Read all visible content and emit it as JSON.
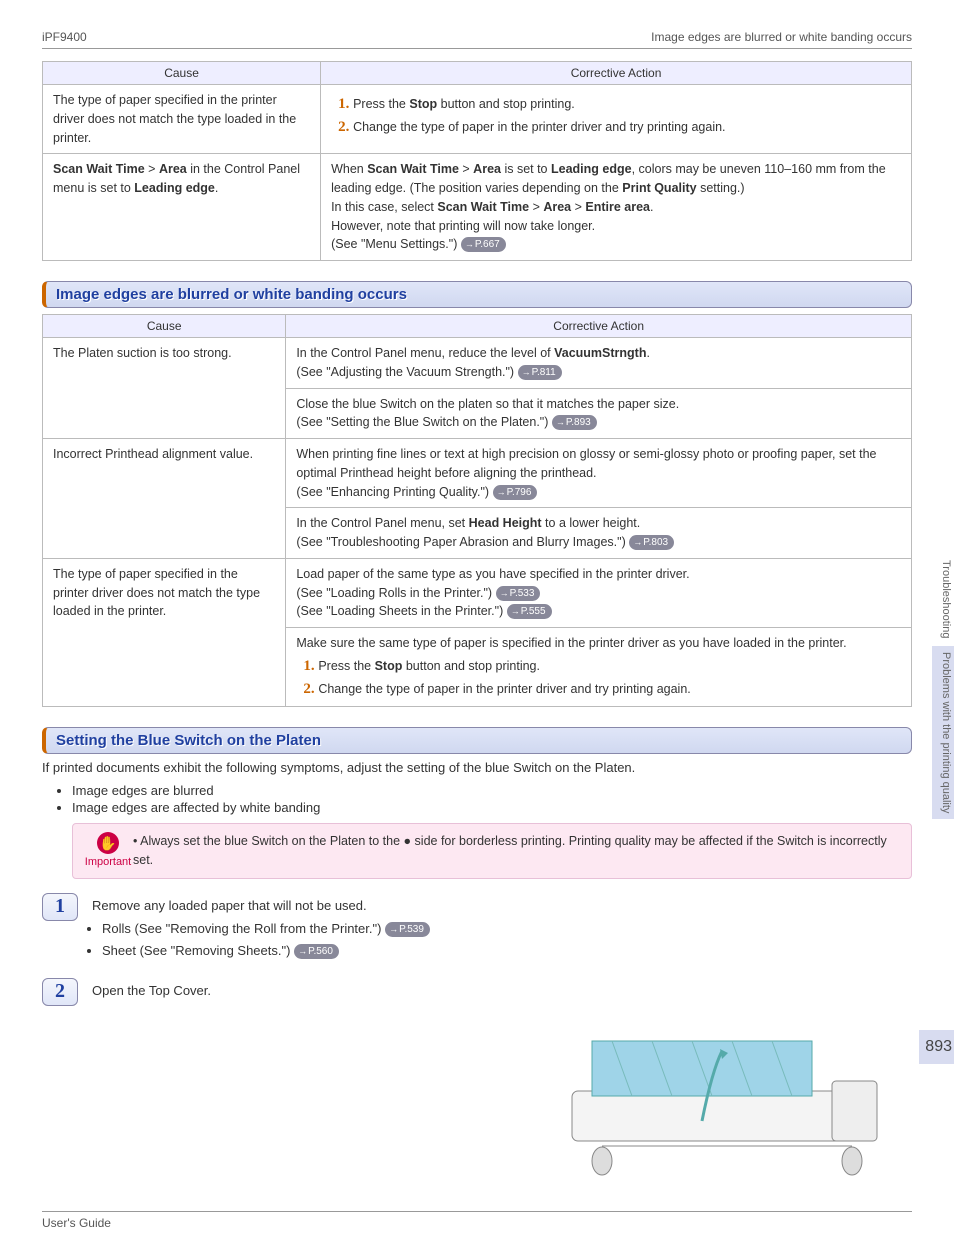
{
  "header": {
    "left": "iPF9400",
    "right": "Image edges are blurred or white banding occurs"
  },
  "footer": {
    "left": "User's Guide"
  },
  "sidebar": {
    "top": "Troubleshooting",
    "bottom": "Problems with the printing quality"
  },
  "pageNumber": "893",
  "table1": {
    "headers": [
      "Cause",
      "Corrective Action"
    ],
    "rows": [
      {
        "cause": "The type of paper specified in the printer driver does not match the type loaded in the printer.",
        "action": {
          "list": [
            "Press the <b>Stop</b> button and stop printing.",
            "Change the type of paper in the printer driver and try printing again."
          ]
        }
      },
      {
        "cause": "<b>Scan Wait Time</b> > <b>Area</b> in the Control Panel menu is set to <b>Leading edge</b>.",
        "action": {
          "html": "When <b>Scan Wait Time</b> > <b>Area</b> is set to <b>Leading edge</b>, colors may be uneven 110–160 mm from the leading edge. (The position varies depending on the <b>Print Quality</b> setting.)<br>In this case, select <b>Scan Wait Time</b> > <b>Area</b> > <b>Entire area</b>.<br>However, note that printing will now take longer.<br>(See \"Menu Settings.\") ",
          "ref": "P.667"
        }
      }
    ]
  },
  "section1": {
    "title": "Image edges are blurred or white banding occurs"
  },
  "table2": {
    "headers": [
      "Cause",
      "Corrective Action"
    ],
    "rows": [
      {
        "cause": "The Platen suction is too strong.",
        "action": {
          "html": "In the Control Panel menu, reduce the level of <b>VacuumStrngth</b>.<br>(See \"Adjusting the Vacuum Strength.\") ",
          "ref": "P.811"
        }
      },
      {
        "cause": "",
        "action": {
          "html": "Close the blue Switch on the platen so that it matches the paper size.<br>(See \"Setting the Blue Switch on the Platen.\") ",
          "ref": "P.893"
        }
      },
      {
        "cause": "Incorrect Printhead alignment value.",
        "action": {
          "html": "When printing fine lines or text at high precision on glossy or semi-glossy photo or proofing paper, set the optimal Printhead height before aligning the printhead.<br>(See \"Enhancing Printing Quality.\") ",
          "ref": "P.796"
        }
      },
      {
        "cause": "",
        "action": {
          "html": "In the Control Panel menu, set <b>Head Height</b> to a lower height.<br>(See \"Troubleshooting Paper Abrasion and Blurry Images.\") ",
          "ref": "P.803"
        }
      },
      {
        "cause": "The type of paper specified in the printer driver does not match the type loaded in the printer.",
        "action": {
          "html": "Load paper of the same type as you have specified in the printer driver.<br>(See \"Loading Rolls in the Printer.\") <span class='pg' data-interactable='true' data-name='page-ref'>P.533</span><br>(See \"Loading Sheets in the Printer.\") ",
          "ref": "P.555"
        }
      },
      {
        "cause": "",
        "action": {
          "html": "Make sure the same type of paper is specified in the printer driver as you have loaded in the printer.",
          "list": [
            "Press the <b>Stop</b> button and stop printing.",
            "Change the type of paper in the printer driver and try printing again."
          ]
        }
      }
    ]
  },
  "section2": {
    "title": "Setting the Blue Switch on the Platen",
    "intro": "If printed documents exhibit the following symptoms, adjust the setting of the blue Switch on the Platen.",
    "bullets": [
      "Image edges are blurred",
      "Image edges are affected by white banding"
    ],
    "note": "Always set the blue Switch on the Platen to the ● side for borderless printing. Printing quality may be affected if the Switch is incorrectly set.",
    "noteLabel": "Important"
  },
  "steps": [
    {
      "num": "1",
      "text": "Remove any loaded paper that will not be used.",
      "sub": [
        {
          "t": "Rolls  (See \"Removing the Roll from the Printer.\") ",
          "ref": "P.539"
        },
        {
          "t": "Sheet  (See \"Removing Sheets.\") ",
          "ref": "P.560"
        }
      ]
    },
    {
      "num": "2",
      "text": "Open the Top Cover."
    }
  ]
}
